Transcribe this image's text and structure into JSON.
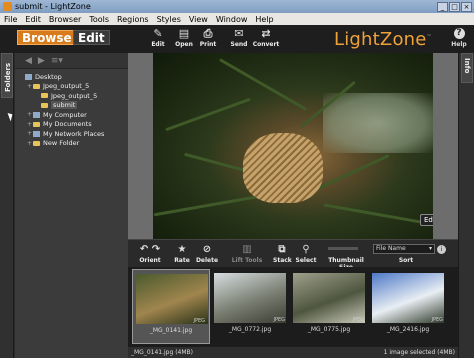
{
  "window": {
    "title": "submit - LightZone",
    "buttons": [
      "_",
      "□",
      "×"
    ]
  },
  "menubar": [
    "File",
    "Edit",
    "Browser",
    "Tools",
    "Regions",
    "Styles",
    "View",
    "Window",
    "Help"
  ],
  "modes": {
    "browse": "Browse",
    "edit": "Edit"
  },
  "toolbar": [
    {
      "label": "Edit",
      "icon": "edit-icon",
      "glyph": "✎"
    },
    {
      "label": "Open",
      "icon": "open-icon",
      "glyph": "▤"
    },
    {
      "label": "Print",
      "icon": "print-icon",
      "glyph": "⎙"
    },
    {
      "label": "Send",
      "icon": "send-icon",
      "glyph": "✉"
    },
    {
      "label": "Convert",
      "icon": "convert-icon",
      "glyph": "⇄"
    }
  ],
  "logo": "LightZone",
  "help": {
    "label": "Help",
    "glyph": "?"
  },
  "left_tab": "Folders",
  "right_tab": "Info",
  "folder_nav": {
    "back": "◀",
    "forward": "▶",
    "menu": "≡▾"
  },
  "tree": [
    {
      "label": "Desktop",
      "indent": 0,
      "kind": "pc",
      "toggle": ""
    },
    {
      "label": "Jpeg_output_5",
      "indent": 1,
      "kind": "folder",
      "toggle": "+"
    },
    {
      "label": "Jpeg_output_5",
      "indent": 2,
      "kind": "folder",
      "toggle": ""
    },
    {
      "label": "submit",
      "indent": 2,
      "kind": "folder",
      "toggle": "",
      "selected": true
    },
    {
      "label": "My Computer",
      "indent": 1,
      "kind": "pc",
      "toggle": "+"
    },
    {
      "label": "My Documents",
      "indent": 1,
      "kind": "folder",
      "toggle": "+"
    },
    {
      "label": "My Network Places",
      "indent": 1,
      "kind": "pc",
      "toggle": "+"
    },
    {
      "label": "New Folder",
      "indent": 1,
      "kind": "folder",
      "toggle": "+"
    }
  ],
  "preview": {
    "badge": "Edit"
  },
  "browser_toolbar": [
    {
      "label": "Orient",
      "icon": "rotate-icon",
      "glyph": "↶ ↷",
      "dim": false
    },
    {
      "label": "Rate",
      "icon": "star-icon",
      "glyph": "★",
      "dim": false
    },
    {
      "label": "Delete",
      "icon": "delete-icon",
      "glyph": "⊘",
      "dim": false
    },
    {
      "label": "Lift Tools",
      "icon": "lift-tools-icon",
      "glyph": "▥",
      "dim": true
    },
    {
      "label": "Stack",
      "icon": "stack-icon",
      "glyph": "⧉",
      "dim": false
    },
    {
      "label": "Select",
      "icon": "select-icon",
      "glyph": "⚲",
      "dim": false
    },
    {
      "label": "Thumbnail Size",
      "icon": "thumbnail-size-icon",
      "glyph": "",
      "dim": false
    },
    {
      "label": "Sort",
      "icon": "sort-icon",
      "glyph": "",
      "dim": false
    }
  ],
  "sort": {
    "value": "File Name",
    "arrow": "▾",
    "info_glyph": "i"
  },
  "thumbnails": [
    {
      "caption": "_MG_0141.jpg",
      "tag": "JPEG",
      "selected": true,
      "colors": [
        "#4b5a2d",
        "#a0854e",
        "#2a3318"
      ]
    },
    {
      "caption": "_MG_0772.jpg",
      "tag": "JPEG",
      "selected": false,
      "colors": [
        "#d7dde0",
        "#7a7f72",
        "#3b3d33"
      ]
    },
    {
      "caption": "_MG_0775.jpg",
      "tag": "JPEG",
      "selected": false,
      "colors": [
        "#9ea08a",
        "#4f5640",
        "#c8c9b8"
      ]
    },
    {
      "caption": "_MG_2416.jpg",
      "tag": "JPEG",
      "selected": false,
      "colors": [
        "#4d78c7",
        "#e8eef3",
        "#2f3a2a"
      ]
    }
  ],
  "status": {
    "left": "_MG_0141.jpg (4MB)",
    "right": "1 image selected (4MB)"
  },
  "colors": {
    "accent": "#d77b1c",
    "logo": "#f0a23a"
  }
}
